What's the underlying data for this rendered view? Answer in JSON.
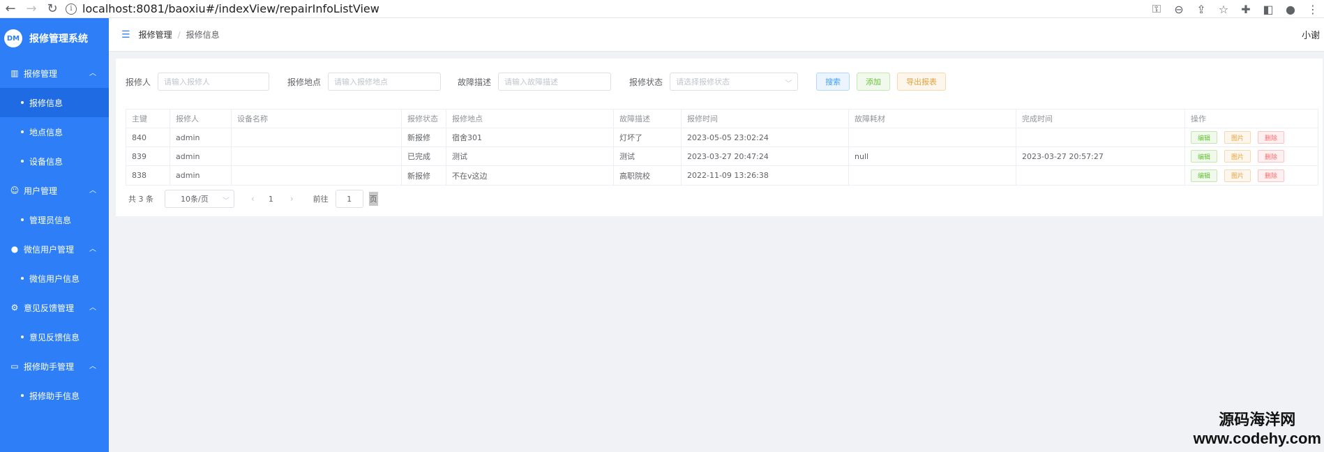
{
  "browser": {
    "url": "localhost:8081/baoxiu#/indexView/repairInfoListView",
    "info_glyph": "i"
  },
  "sidebar": {
    "logo": "DM",
    "title": "报修管理系统",
    "groups": [
      {
        "label": "报修管理",
        "icon": "chart-icon",
        "items": [
          "报修信息",
          "地点信息",
          "设备信息"
        ]
      },
      {
        "label": "用户管理",
        "icon": "user-icon",
        "items": [
          "管理员信息"
        ]
      },
      {
        "label": "微信用户管理",
        "icon": "user-filled-icon",
        "items": [
          "微信用户信息"
        ]
      },
      {
        "label": "意见反馈管理",
        "icon": "gear-icon",
        "items": [
          "意见反馈信息"
        ]
      },
      {
        "label": "报修助手管理",
        "icon": "box-icon",
        "items": [
          "报修助手信息"
        ]
      }
    ]
  },
  "topbar": {
    "crumb1": "报修管理",
    "sep": "/",
    "crumb2": "报修信息",
    "user": "小谢"
  },
  "filters": {
    "reporter_label": "报修人",
    "reporter_placeholder": "请输入报修人",
    "location_label": "报修地点",
    "location_placeholder": "请输入报修地点",
    "fault_label": "故障描述",
    "fault_placeholder": "请输入故障描述",
    "status_label": "报修状态",
    "status_placeholder": "请选择报修状态",
    "search": "搜索",
    "add": "添加",
    "export": "导出报表"
  },
  "table": {
    "headers": [
      "主键",
      "报修人",
      "设备名称",
      "报修状态",
      "报修地点",
      "故障描述",
      "报修时间",
      "故障耗材",
      "完成时间",
      "操作"
    ],
    "rows": [
      [
        "840",
        "admin",
        "",
        "新报修",
        "宿舍301",
        "灯坏了",
        "2023-05-05 23:02:24",
        "",
        ""
      ],
      [
        "839",
        "admin",
        "",
        "已完成",
        "测试",
        "测试",
        "2023-03-27 20:47:24",
        "null",
        "2023-03-27 20:57:27"
      ],
      [
        "838",
        "admin",
        "",
        "新报修",
        "不在v这边",
        "高职院校",
        "2022-11-09 13:26:38",
        "",
        ""
      ]
    ],
    "ops": {
      "edit": "编辑",
      "image": "图片",
      "delete": "删除"
    }
  },
  "pager": {
    "total": "共 3 条",
    "size": "10条/页",
    "prev": "‹",
    "page": "1",
    "next": "›",
    "goto": "前往",
    "goto_value": "1",
    "unit": "页"
  },
  "watermark": {
    "cn": "源码海洋网",
    "en": "www.codehy.com"
  }
}
